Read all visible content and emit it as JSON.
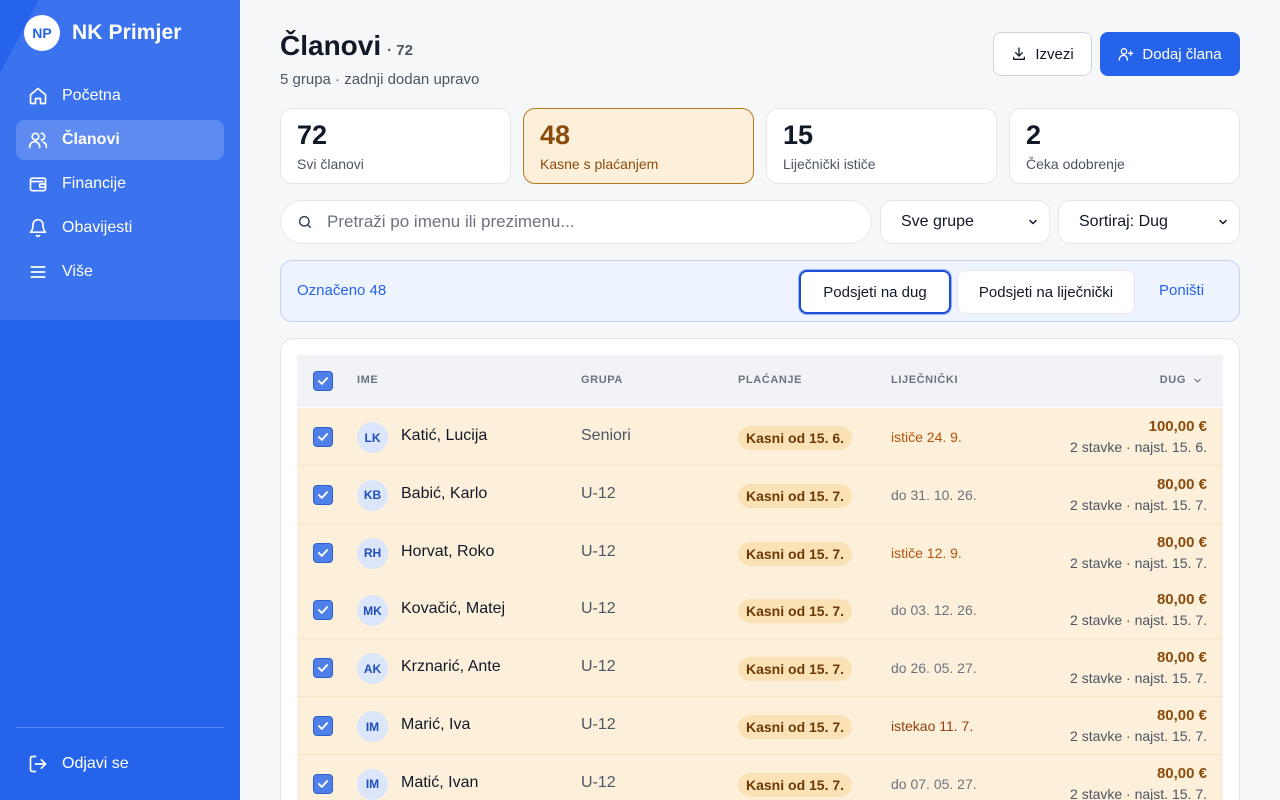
{
  "brand": {
    "initials": "NP",
    "name": "NK Primjer"
  },
  "nav": [
    {
      "label": "Početna",
      "icon": "home-icon"
    },
    {
      "label": "Članovi",
      "icon": "users-icon",
      "active": true
    },
    {
      "label": "Financije",
      "icon": "wallet-icon"
    },
    {
      "label": "Obavijesti",
      "icon": "bell-icon"
    },
    {
      "label": "Više",
      "icon": "menu-icon"
    }
  ],
  "logout_label": "Odjavi se",
  "header": {
    "title": "Članovi",
    "count": "· 72",
    "subtitle": "5 grupa · zadnji dodan upravo",
    "export_label": "Izvezi",
    "add_label": "Dodaj člana"
  },
  "stats": [
    {
      "value": "72",
      "label": "Svi članovi"
    },
    {
      "value": "48",
      "label": "Kasne s plaćanjem",
      "active": true
    },
    {
      "value": "15",
      "label": "Liječnički ističe"
    },
    {
      "value": "2",
      "label": "Čeka odobrenje"
    }
  ],
  "search": {
    "placeholder": "Pretraži po imenu ili prezimenu...",
    "value": ""
  },
  "filters": {
    "group": "Sve grupe",
    "sort": "Sortiraj: Dug"
  },
  "bulk": {
    "selected_label": "Označeno 48",
    "remind_debt": "Podsjeti na dug",
    "remind_medical": "Podsjeti na liječnički",
    "cancel": "Poništi"
  },
  "table": {
    "columns": {
      "name": "IME",
      "group": "GRUPA",
      "payment": "PLAĆANJE",
      "medical": "LIJEČNIČKI",
      "debt": "DUG"
    },
    "rows": [
      {
        "initials": "LK",
        "name": "Katić, Lucija",
        "group": "Seniori",
        "payment": "Kasni od 15. 6.",
        "medical": "ističe 24. 9.",
        "medical_state": "warn",
        "amount": "100,00 €",
        "meta": "2 stavke · najst. 15. 6."
      },
      {
        "initials": "KB",
        "name": "Babić, Karlo",
        "group": "U-12",
        "payment": "Kasni od 15. 7.",
        "medical": "do 31. 10. 26.",
        "medical_state": "ok",
        "amount": "80,00 €",
        "meta": "2 stavke · najst. 15. 7."
      },
      {
        "initials": "RH",
        "name": "Horvat, Roko",
        "group": "U-12",
        "payment": "Kasni od 15. 7.",
        "medical": "ističe 12. 9.",
        "medical_state": "warn",
        "amount": "80,00 €",
        "meta": "2 stavke · najst. 15. 7."
      },
      {
        "initials": "MK",
        "name": "Kovačić, Matej",
        "group": "U-12",
        "payment": "Kasni od 15. 7.",
        "medical": "do 03. 12. 26.",
        "medical_state": "ok",
        "amount": "80,00 €",
        "meta": "2 stavke · najst. 15. 7."
      },
      {
        "initials": "AK",
        "name": "Krznarić, Ante",
        "group": "U-12",
        "payment": "Kasni od 15. 7.",
        "medical": "do 26. 05. 27.",
        "medical_state": "ok",
        "amount": "80,00 €",
        "meta": "2 stavke · najst. 15. 7."
      },
      {
        "initials": "IM",
        "name": "Marić, Iva",
        "group": "U-12",
        "payment": "Kasni od 15. 7.",
        "medical": "istekao 11. 7.",
        "medical_state": "expired",
        "amount": "80,00 €",
        "meta": "2 stavke · najst. 15. 7."
      },
      {
        "initials": "IM",
        "name": "Matić, Ivan",
        "group": "U-12",
        "payment": "Kasni od 15. 7.",
        "medical": "do 07. 05. 27.",
        "medical_state": "ok",
        "amount": "80,00 €",
        "meta": "2 stavke · najst. 15. 7."
      }
    ]
  },
  "colors": {
    "primary": "#2563eb",
    "overdue_bg": "#fdf0db",
    "overdue_text": "#8a4b0b"
  }
}
